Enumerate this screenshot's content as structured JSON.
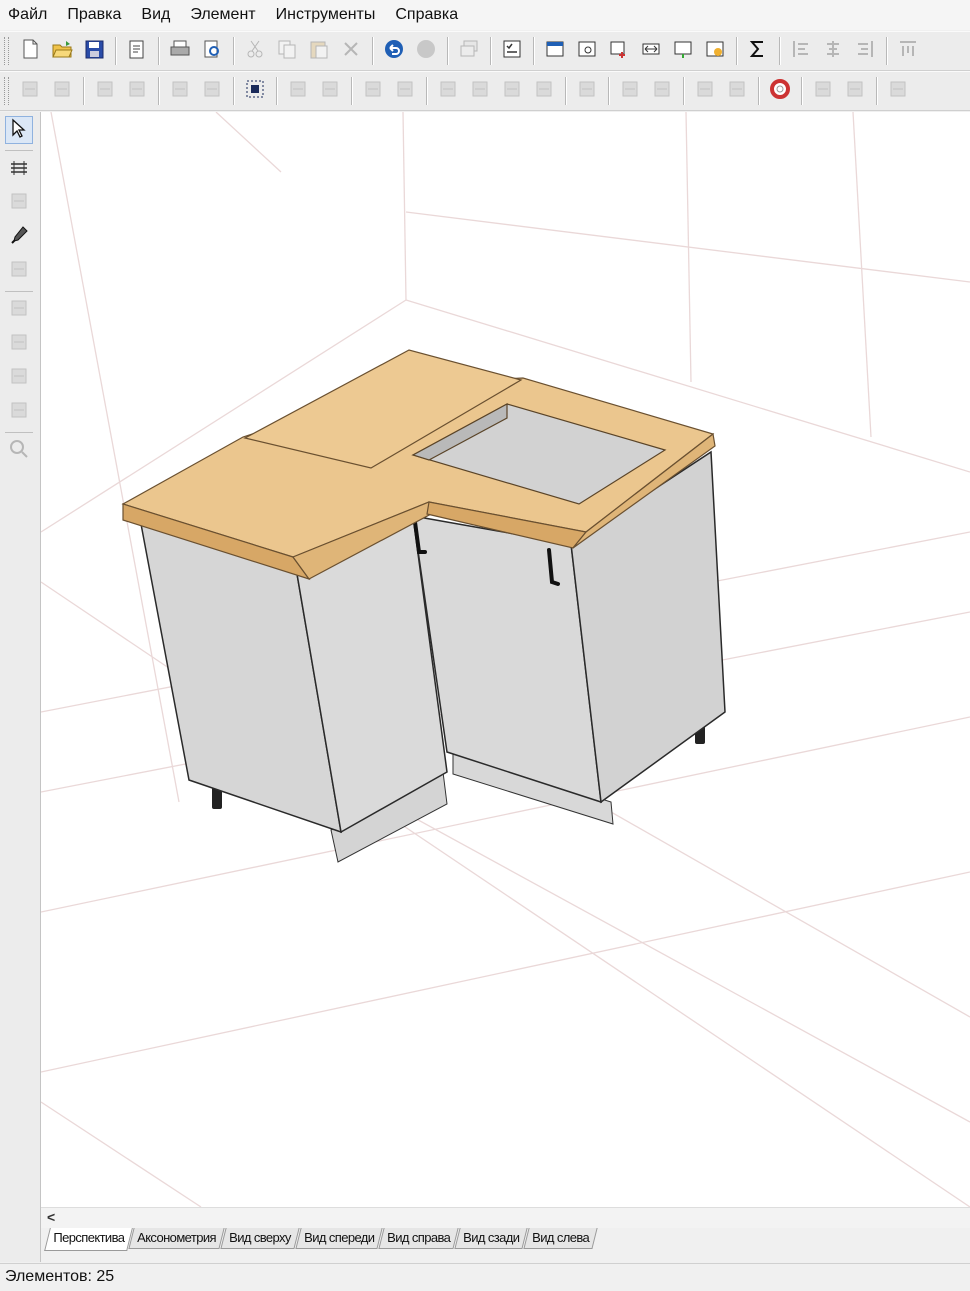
{
  "menu": [
    "Файл",
    "Правка",
    "Вид",
    "Элемент",
    "Инструменты",
    "Справка"
  ],
  "toolbar1": {
    "groups": [
      [
        "new-file-icon",
        "open-folder-icon",
        "save-icon"
      ],
      [
        "properties-icon"
      ],
      [
        "print-icon",
        "print-preview-icon"
      ],
      [
        "cut-icon",
        "copy-icon",
        "paste-icon",
        "delete-icon"
      ],
      [
        "undo-icon",
        "redo-icon"
      ],
      [
        "multi-window-icon"
      ],
      [
        "checklist-icon"
      ],
      [
        "panel-icon",
        "find-panel-icon",
        "move-panel-icon",
        "width-icon",
        "export-icon",
        "report-icon"
      ],
      [
        "sum-icon"
      ],
      [
        "align-left-icon",
        "align-center-icon",
        "align-right-icon"
      ],
      [
        "align-top-icon"
      ]
    ],
    "enabled": [
      "new-file-icon",
      "open-folder-icon",
      "save-icon",
      "properties-icon",
      "print-icon",
      "print-preview-icon",
      "undo-icon",
      "checklist-icon",
      "panel-icon",
      "find-panel-icon",
      "move-panel-icon",
      "width-icon",
      "export-icon",
      "report-icon",
      "sum-icon"
    ]
  },
  "toolbar2": {
    "groups": [
      [
        "mirror-left-icon",
        "mirror-right-icon"
      ],
      [
        "flip-up-icon",
        "flip-down-icon"
      ],
      [
        "rotate-shape-icon",
        "rotate-shape-2-icon"
      ],
      [
        "select-grid-icon"
      ],
      [
        "frame-icon",
        "frame-2-icon"
      ],
      [
        "move-up-icon",
        "move-down-icon"
      ],
      [
        "rotate-icon",
        "move-icon",
        "scale-icon",
        "stretch-icon"
      ],
      [
        "profile-icon"
      ],
      [
        "ellipse-icon",
        "ellipse-2-icon"
      ],
      [
        "eye-icon",
        "eye-2-icon"
      ],
      [
        "lifebuoy-icon"
      ],
      [
        "dimension-icon",
        "dimension-2-icon"
      ],
      [
        "text-cursor-icon"
      ]
    ],
    "enabled": [
      "select-grid-icon",
      "lifebuoy-icon"
    ]
  },
  "left_toolbar": [
    {
      "icon": "cursor-icon",
      "enabled": true,
      "active": true
    },
    {
      "sep": true
    },
    {
      "icon": "layers-icon",
      "enabled": true
    },
    {
      "icon": "measure-icon",
      "enabled": false
    },
    {
      "icon": "eyedropper-icon",
      "enabled": true
    },
    {
      "icon": "shape-icon",
      "enabled": false
    },
    {
      "sep": true
    },
    {
      "icon": "edit-panel-icon",
      "enabled": false
    },
    {
      "icon": "edit-panel-2-icon",
      "enabled": false
    },
    {
      "icon": "edit-panel-3-icon",
      "enabled": false
    },
    {
      "icon": "edit-panel-4-icon",
      "enabled": false
    },
    {
      "sep": true
    },
    {
      "icon": "zoom-icon",
      "enabled": false
    }
  ],
  "colors": {
    "countertop": "#ebc68e",
    "countertop_edge": "#d7a766",
    "cabinet_front": "#dcdcdc",
    "cabinet_side": "#c9c9c9",
    "sink_cutout": "#d2d2d2",
    "grid_line": "#e8d2d2",
    "accent": "#1f5fb5"
  },
  "scroll_arrow": "<",
  "view_tabs": [
    "Перспектива",
    "Аксонометрия",
    "Вид сверху",
    "Вид спереди",
    "Вид справа",
    "Вид сзади",
    "Вид слева"
  ],
  "active_tab": "Перспектива",
  "status": "Элементов: 25"
}
